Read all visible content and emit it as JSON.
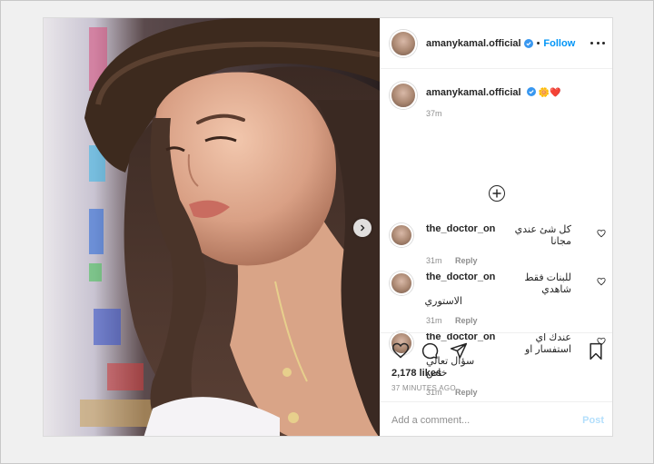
{
  "post": {
    "author": {
      "username": "amanykamal.official",
      "verified": true,
      "follow_label": "Follow",
      "separator": "•"
    },
    "caption": {
      "username": "amanykamal.official",
      "emojis": "🌼❤️",
      "age": "37m"
    },
    "comments": [
      {
        "username": "the_doctor_on",
        "text_line1": "كل شئ عندي مجانا",
        "text_line2": "",
        "age": "31m",
        "reply_label": "Reply"
      },
      {
        "username": "the_doctor_on",
        "text_line1": "للبنات فقط شاهدي",
        "text_line2": "الاستوري",
        "age": "31m",
        "reply_label": "Reply"
      },
      {
        "username": "the_doctor_on",
        "text_line1": "عندك اي استفسار او",
        "text_line2": "سؤال تعالي خاص",
        "age": "31m",
        "reply_label": "Reply"
      }
    ],
    "likes": "2,178 likes",
    "timestamp": "37 MINUTES AGO",
    "add_comment": {
      "placeholder": "Add a comment...",
      "post_label": "Post"
    }
  },
  "icons": {
    "more": "more-options-icon",
    "load_more": "plus-circle-icon",
    "like": "heart-icon",
    "comment": "comment-icon",
    "share": "paper-plane-icon",
    "save": "bookmark-icon",
    "carousel_next": "chevron-right-icon"
  },
  "colors": {
    "accent": "#0095f6",
    "post_disabled": "#b3dffc",
    "muted": "#8e8e8e",
    "text": "#262626"
  }
}
